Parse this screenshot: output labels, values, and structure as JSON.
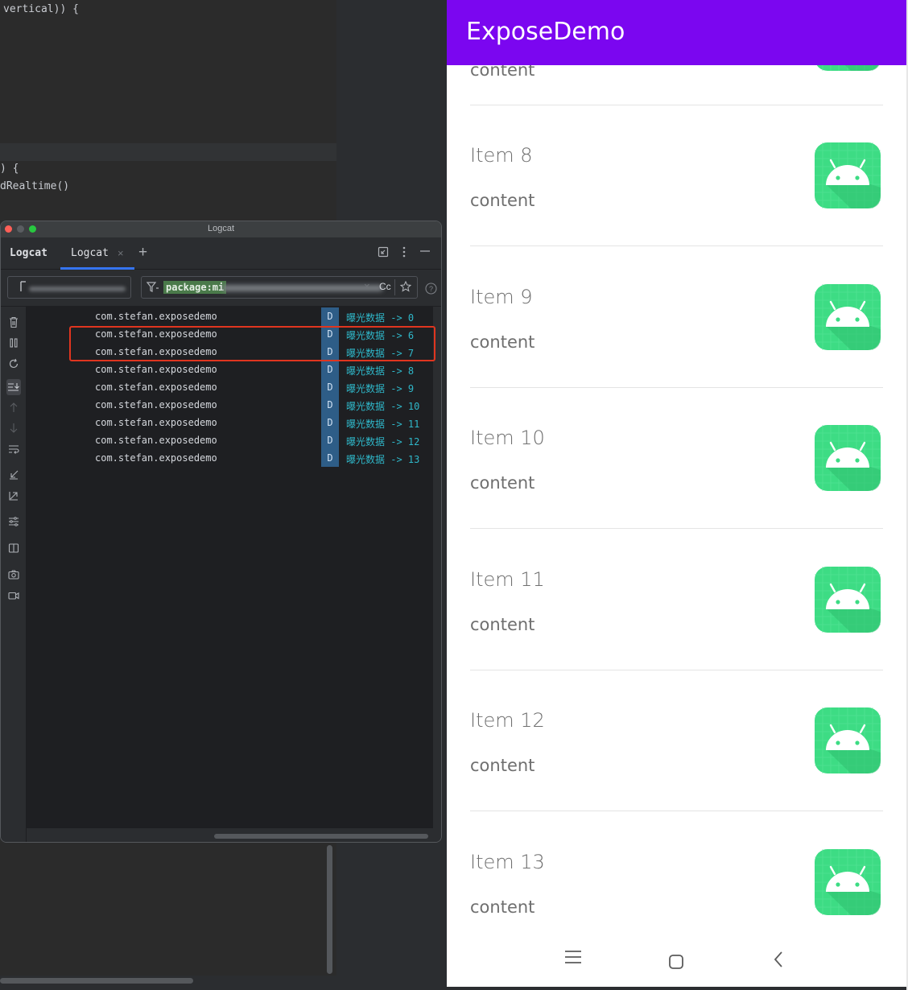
{
  "editor": {
    "code_lines": [
      "vertical)) {",
      ") {",
      "dRealtime()"
    ]
  },
  "logcat": {
    "window_title": "Logcat",
    "tabs": [
      {
        "label": "Logcat"
      },
      {
        "label": "Logcat",
        "close": "×"
      }
    ],
    "add_tab_label": "+",
    "filter_text": "package:mi",
    "filter_clear": "×",
    "match_case_label": "Cc",
    "level_badge": "D",
    "rows": [
      {
        "package": "com.stefan.exposedemo",
        "level": "D",
        "message": "曝光数据 -> 0"
      },
      {
        "package": "com.stefan.exposedemo",
        "level": "D",
        "message": "曝光数据 -> 6"
      },
      {
        "package": "com.stefan.exposedemo",
        "level": "D",
        "message": "曝光数据 -> 7"
      },
      {
        "package": "com.stefan.exposedemo",
        "level": "D",
        "message": "曝光数据 -> 8"
      },
      {
        "package": "com.stefan.exposedemo",
        "level": "D",
        "message": "曝光数据 -> 9"
      },
      {
        "package": "com.stefan.exposedemo",
        "level": "D",
        "message": "曝光数据 -> 10"
      },
      {
        "package": "com.stefan.exposedemo",
        "level": "D",
        "message": "曝光数据 -> 11"
      },
      {
        "package": "com.stefan.exposedemo",
        "level": "D",
        "message": "曝光数据 -> 12"
      },
      {
        "package": "com.stefan.exposedemo",
        "level": "D",
        "message": "曝光数据 -> 13"
      }
    ],
    "highlight_color": "#e0351f",
    "accent": "#3574f0"
  },
  "phone": {
    "app_title": "ExposeDemo",
    "appbar_color": "#7b06f0",
    "partial_content": "content",
    "items": [
      {
        "title": "Item 8",
        "content": "content"
      },
      {
        "title": "Item 9",
        "content": "content"
      },
      {
        "title": "Item 10",
        "content": "content"
      },
      {
        "title": "Item 11",
        "content": "content"
      },
      {
        "title": "Item 12",
        "content": "content"
      },
      {
        "title": "Item 13",
        "content": "content"
      }
    ],
    "icon_name": "android-launcher-icon",
    "icon_color": "#3ddc84",
    "nav": {
      "menu": "☰",
      "home": "▢",
      "back": "‹"
    }
  }
}
